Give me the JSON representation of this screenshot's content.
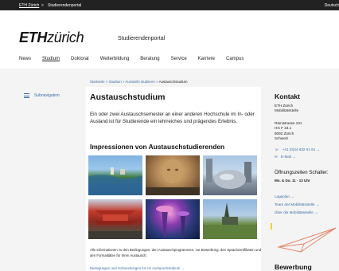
{
  "topbar": {
    "crumb_home": "ETH Zürich",
    "crumb_sep": ">",
    "crumb_current": "Studierendenportal",
    "language": "Deutsch"
  },
  "logo": {
    "eth": "ETH",
    "zurich": "zürich"
  },
  "portal_name": "Studierendenportal",
  "nav": {
    "items": [
      "News",
      "Studium",
      "Doktorat",
      "Weiterbildung",
      "Beratung",
      "Service",
      "Karriere",
      "Campus"
    ],
    "active": "Studium"
  },
  "breadcrumb": {
    "items": [
      "Startseite",
      "Studium",
      "Auswärts studieren"
    ],
    "separator": ">",
    "current": "Austauschstudium"
  },
  "subnavigation_label": "Subnavigation",
  "main": {
    "title": "Austauschstudium",
    "intro": "Ein oder zwei Austauschsemester an einer anderen Hochschule im In- oder Ausland ist für Studierende ein lehrreiches und prägendes Erlebnis.",
    "gallery_title": "Impressionen von Austauschstudierenden",
    "bottom_text": "Alle Informationen zu den Bedingungen, den Austauschprogrammen, zur Bewerbung, den Sprachzertifikaten und den Formalitäten für Ihren Austausch:",
    "bottom_link": "Bedingungen und Vorbereitungen für ein Austauschstudium →"
  },
  "sidebar": {
    "kontakt_title": "Kontakt",
    "org_line1": "ETH Zürich",
    "org_line2": "Mobilitätsstelle",
    "addr_line1": "Rämistrasse 101",
    "addr_line2": "HG F 23.1",
    "addr_line3": "8092 Zürich",
    "addr_line4": "Schweiz",
    "phone": "+41 (0)44 632 61 61 →",
    "email": "E-Mail →",
    "hours_title": "Öffnungszeiten Schalter:",
    "hours": "Mo. & Do. 11 - 13 Uhr",
    "links": [
      "Lageplan →",
      "Team der Mobilitätsstelle →",
      "Über die Mobilitätsstelle →"
    ],
    "bewerbung_title": "Bewerbung"
  },
  "colors": {
    "link": "#3d6ea5",
    "topbar": "#222222",
    "accent_yellow": "#f2d21b"
  }
}
